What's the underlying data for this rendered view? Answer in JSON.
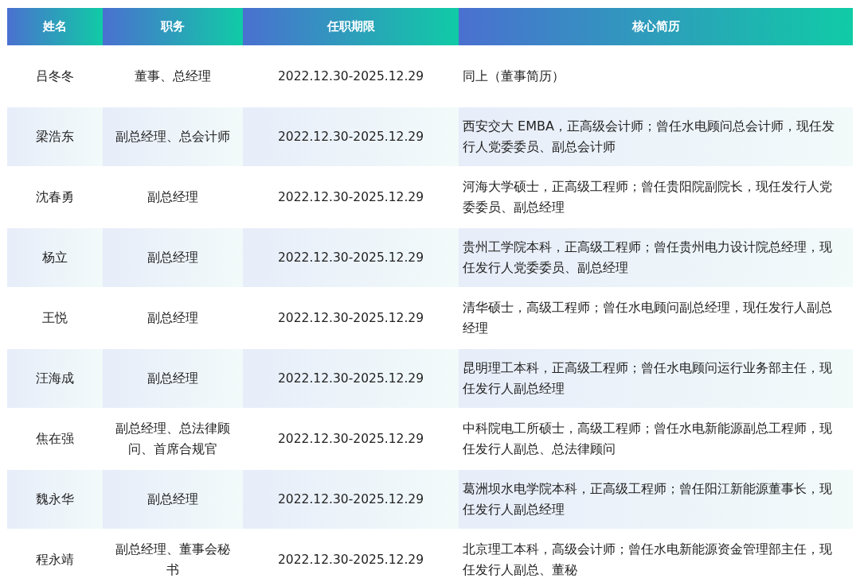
{
  "table": {
    "columns": [
      "姓名",
      "职务",
      "任职期限",
      "核心简历"
    ],
    "rows": [
      [
        "吕冬冬",
        "董事、总经理",
        "2022.12.30-2025.12.29",
        "同上（董事简历）"
      ],
      [
        "梁浩东",
        "副总经理、总会计师",
        "2022.12.30-2025.12.29",
        "西安交大 EMBA，正高级会计师；曾任水电顾问总会计师，现任发行人党委委员、副总会计师"
      ],
      [
        "沈春勇",
        "副总经理",
        "2022.12.30-2025.12.29",
        "河海大学硕士，正高级工程师；曾任贵阳院副院长，现任发行人党委委员、副总经理"
      ],
      [
        "杨立",
        "副总经理",
        "2022.12.30-2025.12.29",
        "贵州工学院本科，正高级工程师；曾任贵州电力设计院总经理，现任发行人党委委员、副总经理"
      ],
      [
        "王悦",
        "副总经理",
        "2022.12.30-2025.12.29",
        "清华硕士，高级工程师；曾任水电顾问副总经理，现任发行人副总经理"
      ],
      [
        "汪海成",
        "副总经理",
        "2022.12.30-2025.12.29",
        "昆明理工本科，正高级工程师；曾任水电顾问运行业务部主任，现任发行人副总经理"
      ],
      [
        "焦在强",
        "副总经理、总法律顾问、首席合规官",
        "2022.12.30-2025.12.29",
        "中科院电工所硕士，高级工程师；曾任水电新能源副总工程师，现任发行人副总、总法律顾问"
      ],
      [
        "魏永华",
        "副总经理",
        "2022.12.30-2025.12.29",
        "葛洲坝水电学院本科，正高级工程师；曾任阳江新能源董事长，现任发行人副总经理"
      ],
      [
        "程永靖",
        "副总经理、董事会秘书",
        "2022.12.30-2025.12.29",
        "北京理工本科，高级会计师；曾任水电新能源资金管理部主任，现任发行人副总、董秘"
      ]
    ]
  }
}
